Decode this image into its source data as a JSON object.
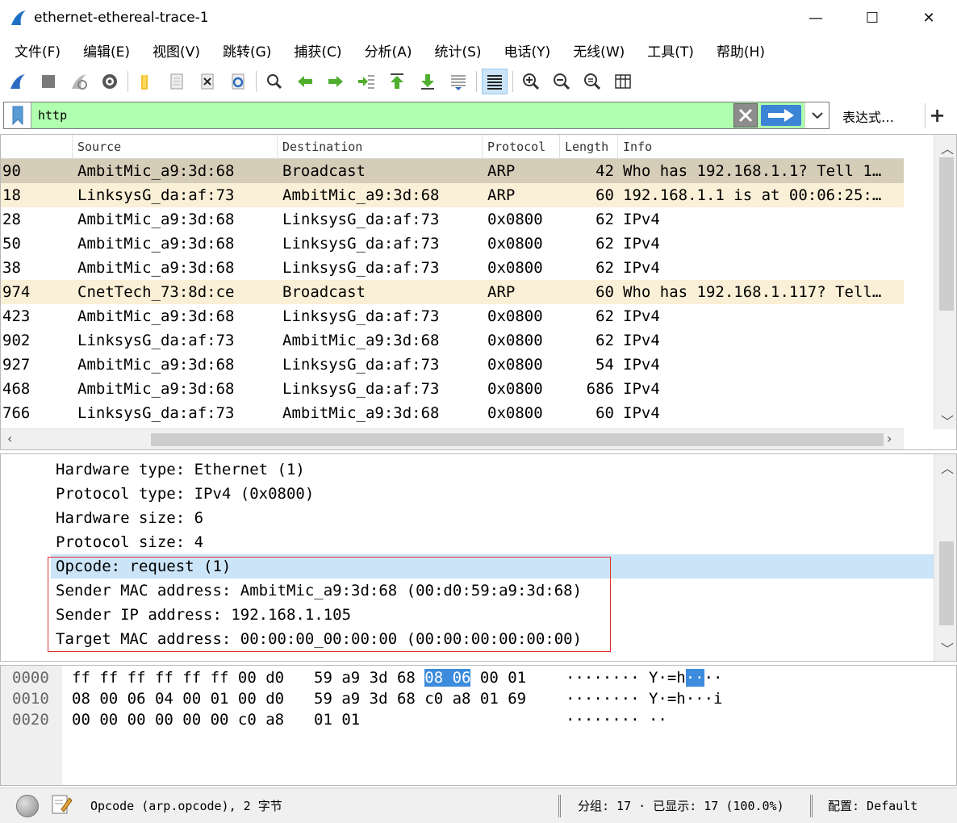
{
  "window": {
    "title": "ethernet-ethereal-trace-1",
    "minimize": "—",
    "maximize": "☐",
    "close": "✕"
  },
  "menu": [
    "文件(F)",
    "编辑(E)",
    "视图(V)",
    "跳转(G)",
    "捕获(C)",
    "分析(A)",
    "统计(S)",
    "电话(Y)",
    "无线(W)",
    "工具(T)",
    "帮助(H)"
  ],
  "toolbar_icons": [
    "shark-fin-icon",
    "stop-icon",
    "restart-icon",
    "capture-options-icon",
    "open-folder-icon",
    "file-icon",
    "close-file-icon",
    "reload-icon",
    "find-icon",
    "back-arrow-icon",
    "forward-arrow-icon",
    "go-to-packet-icon",
    "first-packet-icon",
    "last-packet-icon",
    "autoscroll-icon",
    "colorize-icon",
    "zoom-in-icon",
    "zoom-out-icon",
    "normal-size-icon",
    "resize-columns-icon"
  ],
  "filter": {
    "value": "http",
    "expression_label": "表达式…",
    "plus_label": "+"
  },
  "packet_list": {
    "columns": [
      "Source",
      "Destination",
      "Protocol",
      "Length",
      "Info"
    ],
    "rows": [
      {
        "time": "90",
        "source": "AmbitMic_a9:3d:68",
        "destination": "Broadcast",
        "protocol": "ARP",
        "length": "42",
        "info": "Who has 192.168.1.1? Tell 1…",
        "style": "sel"
      },
      {
        "time": "18",
        "source": "LinksysG_da:af:73",
        "destination": "AmbitMic_a9:3d:68",
        "protocol": "ARP",
        "length": "60",
        "info": "192.168.1.1 is at 00:06:25:…",
        "style": "arp"
      },
      {
        "time": "28",
        "source": "AmbitMic_a9:3d:68",
        "destination": "LinksysG_da:af:73",
        "protocol": "0x0800",
        "length": "62",
        "info": "IPv4",
        "style": "white"
      },
      {
        "time": "50",
        "source": "AmbitMic_a9:3d:68",
        "destination": "LinksysG_da:af:73",
        "protocol": "0x0800",
        "length": "62",
        "info": "IPv4",
        "style": "white"
      },
      {
        "time": "38",
        "source": "AmbitMic_a9:3d:68",
        "destination": "LinksysG_da:af:73",
        "protocol": "0x0800",
        "length": "62",
        "info": "IPv4",
        "style": "white"
      },
      {
        "time": "974",
        "source": "CnetTech_73:8d:ce",
        "destination": "Broadcast",
        "protocol": "ARP",
        "length": "60",
        "info": "Who has 192.168.1.117? Tell…",
        "style": "arp"
      },
      {
        "time": "423",
        "source": "AmbitMic_a9:3d:68",
        "destination": "LinksysG_da:af:73",
        "protocol": "0x0800",
        "length": "62",
        "info": "IPv4",
        "style": "white"
      },
      {
        "time": "902",
        "source": "LinksysG_da:af:73",
        "destination": "AmbitMic_a9:3d:68",
        "protocol": "0x0800",
        "length": "62",
        "info": "IPv4",
        "style": "white"
      },
      {
        "time": "927",
        "source": "AmbitMic_a9:3d:68",
        "destination": "LinksysG_da:af:73",
        "protocol": "0x0800",
        "length": "54",
        "info": "IPv4",
        "style": "white"
      },
      {
        "time": "468",
        "source": "AmbitMic_a9:3d:68",
        "destination": "LinksysG_da:af:73",
        "protocol": "0x0800",
        "length": "686",
        "info": "IPv4",
        "style": "white"
      },
      {
        "time": "766",
        "source": "LinksysG_da:af:73",
        "destination": "AmbitMic_a9:3d:68",
        "protocol": "0x0800",
        "length": "60",
        "info": "IPv4",
        "style": "white"
      }
    ]
  },
  "details": {
    "lines": [
      "Hardware type: Ethernet (1)",
      "Protocol type: IPv4 (0x0800)",
      "Hardware size: 6",
      "Protocol size: 4",
      "Opcode: request (1)",
      "Sender MAC address: AmbitMic_a9:3d:68 (00:d0:59:a9:3d:68)",
      "Sender IP address: 192.168.1.105",
      "Target MAC address: 00:00:00_00:00:00 (00:00:00:00:00:00)"
    ],
    "selected_index": 4
  },
  "bytes": {
    "lines": [
      {
        "offset": "0000",
        "hex_a": "ff ff ff ff ff ff 00 d0",
        "hex_b1": "59 a9 3d 68 ",
        "hex_b_hl": "08 06",
        "hex_b2": " 00 01",
        "ascii_a": "········ Y·=h",
        "ascii_hl": "··",
        "ascii_b": "··"
      },
      {
        "offset": "0010",
        "hex_a": "08 00 06 04 00 01 00 d0",
        "hex_b1": "59 a9 3d 68 c0 a8 01 69",
        "hex_b_hl": "",
        "hex_b2": "",
        "ascii_a": "········ Y·=h···i",
        "ascii_hl": "",
        "ascii_b": ""
      },
      {
        "offset": "0020",
        "hex_a": "00 00 00 00 00 00 c0 a8",
        "hex_b1": "01 01",
        "hex_b_hl": "",
        "hex_b2": "",
        "ascii_a": "········ ··",
        "ascii_hl": "",
        "ascii_b": ""
      }
    ]
  },
  "status": {
    "field_info": "Opcode (arp.opcode), 2 字节",
    "packets": "分组: 17 · 已显示: 17 (100.0%)",
    "profile": "配置: Default"
  },
  "colors": {
    "filter_valid": "#afffaf",
    "selected_row": "#d6cdb8",
    "arp_row": "#faf0d7",
    "detail_selected": "#cce4f7",
    "byte_highlight": "#3c8bdc"
  }
}
